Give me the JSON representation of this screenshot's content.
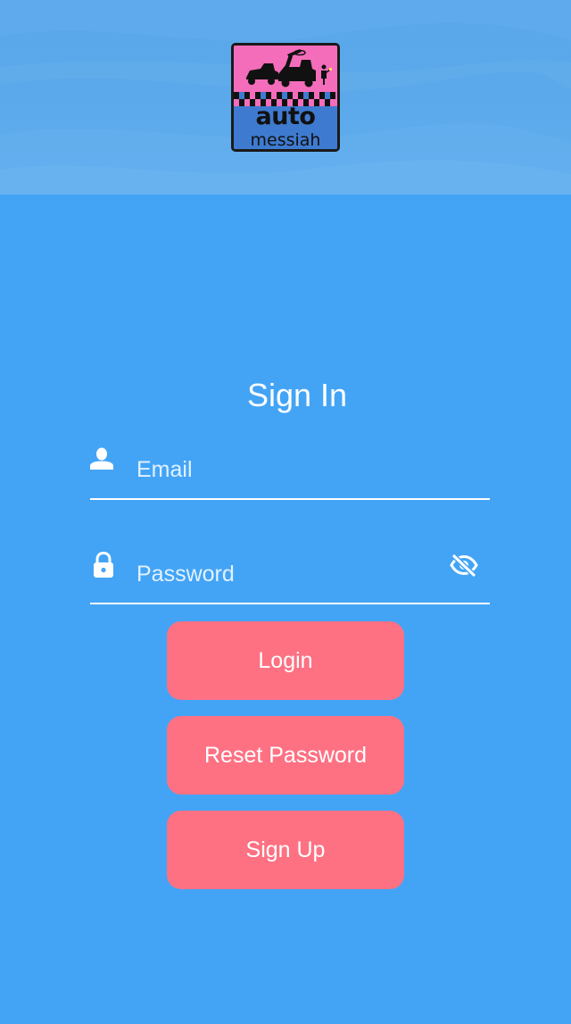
{
  "brand": {
    "logo_line1": "auto",
    "logo_line2": "messiah"
  },
  "signin": {
    "title": "Sign In"
  },
  "form": {
    "email_placeholder": "Email",
    "email_value": "",
    "password_placeholder": "Password",
    "password_value": ""
  },
  "buttons": {
    "login": "Login",
    "reset_password": "Reset Password",
    "sign_up": "Sign Up"
  },
  "icons": {
    "email": "user-icon",
    "password": "lock-icon",
    "visibility": "eye-off-icon"
  },
  "colors": {
    "background": "#43a4f6",
    "button": "#fd7183",
    "text": "#ffffff",
    "logo_pink": "#f46dbb",
    "logo_blue": "#3e7bd0"
  }
}
